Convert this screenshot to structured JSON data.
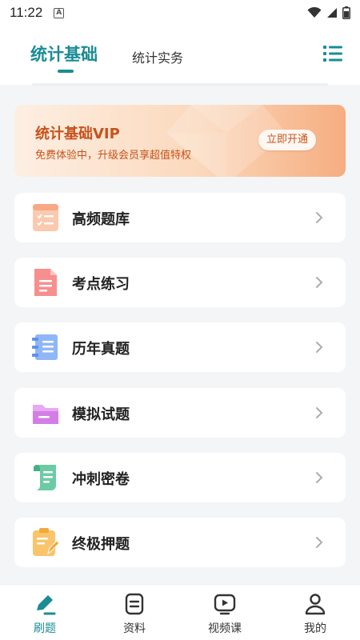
{
  "status_bar": {
    "time": "11:22",
    "notif": "A"
  },
  "header": {
    "tabs": [
      {
        "label": "统计基础",
        "active": true
      },
      {
        "label": "统计实务",
        "active": false
      }
    ]
  },
  "vip": {
    "title": "统计基础VIP",
    "subtitle": "免费体验中，升级会员享超值特权",
    "button": "立即开通"
  },
  "menu": [
    {
      "label": "高频题库",
      "icon": "checklist-icon"
    },
    {
      "label": "考点练习",
      "icon": "document-icon"
    },
    {
      "label": "历年真题",
      "icon": "book-icon"
    },
    {
      "label": "模拟试题",
      "icon": "folder-icon"
    },
    {
      "label": "冲刺密卷",
      "icon": "scroll-icon"
    },
    {
      "label": "终极押题",
      "icon": "clipboard-edit-icon"
    }
  ],
  "bottom_nav": [
    {
      "label": "刷题",
      "active": true,
      "icon": "pen-icon"
    },
    {
      "label": "资料",
      "active": false,
      "icon": "notes-icon"
    },
    {
      "label": "视频课",
      "active": false,
      "icon": "video-icon"
    },
    {
      "label": "我的",
      "active": false,
      "icon": "user-icon"
    }
  ],
  "colors": {
    "accent": "#1a8c95",
    "vip_text": "#c6531d"
  }
}
